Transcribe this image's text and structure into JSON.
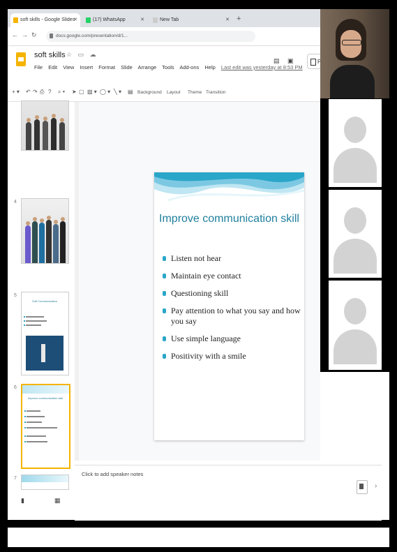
{
  "browser": {
    "tabs": [
      {
        "label": "soft skills - Google Slides",
        "favicon_color": "#f4b400",
        "active": true
      },
      {
        "label": "(17) WhatsApp",
        "favicon_color": "#25d366",
        "active": false
      },
      {
        "label": "New Tab",
        "favicon_color": "#cccccc",
        "active": false
      }
    ],
    "url": "docs.google.com/presentation/d/1..."
  },
  "docs": {
    "title": "soft skills",
    "menu": [
      "File",
      "Edit",
      "View",
      "Insert",
      "Format",
      "Slide",
      "Arrange",
      "Tools",
      "Add-ons",
      "Help"
    ],
    "last_edit": "Last edit was yesterday at 8:53 PM",
    "present_label": "Pres"
  },
  "toolbar": {
    "background": "Background",
    "layout": "Layout",
    "theme": "Theme",
    "transition": "Transition"
  },
  "filmstrip": {
    "numbers": [
      "",
      "4",
      "5",
      "6",
      "7"
    ],
    "mini_slide_5_title": "Soft Communication",
    "mini_slide_6_title": "Improve communication skill"
  },
  "slide": {
    "title": "Improve communication skill",
    "bullets": [
      "Listen not hear",
      "Maintain eye contact",
      "Questioning skill",
      "Pay attention to what you say and how you say",
      "Use simple language",
      "Positivity with a smile"
    ],
    "accent_color": "#2aa6c9"
  },
  "notes": {
    "placeholder": "Click to add speaker notes"
  },
  "icons": {
    "present": "present-icon",
    "comments": "comment-icon",
    "grid": "grid-view-icon",
    "explore": "explore-icon"
  }
}
